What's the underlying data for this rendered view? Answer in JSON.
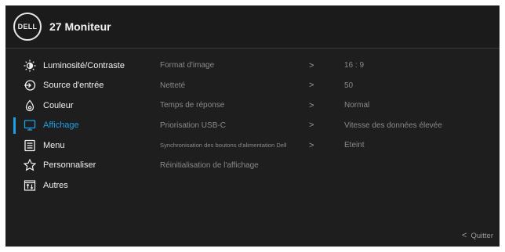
{
  "header": {
    "logo_text": "DELL",
    "title": "27 Moniteur"
  },
  "menu": {
    "items": [
      {
        "label": "Luminosité/Contraste",
        "icon": "brightness-icon"
      },
      {
        "label": "Source d'entrée",
        "icon": "input-source-icon"
      },
      {
        "label": "Couleur",
        "icon": "color-icon"
      },
      {
        "label": "Affichage",
        "icon": "display-icon",
        "active": true
      },
      {
        "label": "Menu",
        "icon": "menu-icon"
      },
      {
        "label": "Personnaliser",
        "icon": "star-icon"
      },
      {
        "label": "Autres",
        "icon": "others-icon"
      }
    ]
  },
  "submenu": {
    "rows": [
      {
        "label": "Format d'image",
        "arrow": ">",
        "value": "16 : 9"
      },
      {
        "label": "Netteté",
        "arrow": ">",
        "value": "50"
      },
      {
        "label": "Temps de réponse",
        "arrow": ">",
        "value": "Normal"
      },
      {
        "label": "Priorisation USB-C",
        "arrow": ">",
        "value": "Vitesse des données élevée"
      },
      {
        "label": "Synchronisation des boutons d'alimentation Dell",
        "arrow": ">",
        "value": "Eteint"
      },
      {
        "label": "Réinitialisation de l'affichage",
        "arrow": "",
        "value": ""
      }
    ]
  },
  "footer": {
    "quit_label": "Quitter",
    "quit_chevron": "<"
  },
  "colors": {
    "background": "#1e1e1f",
    "accent": "#1aa0e6",
    "text": "#f0f0f0",
    "dim_text": "#8a8a8c"
  }
}
